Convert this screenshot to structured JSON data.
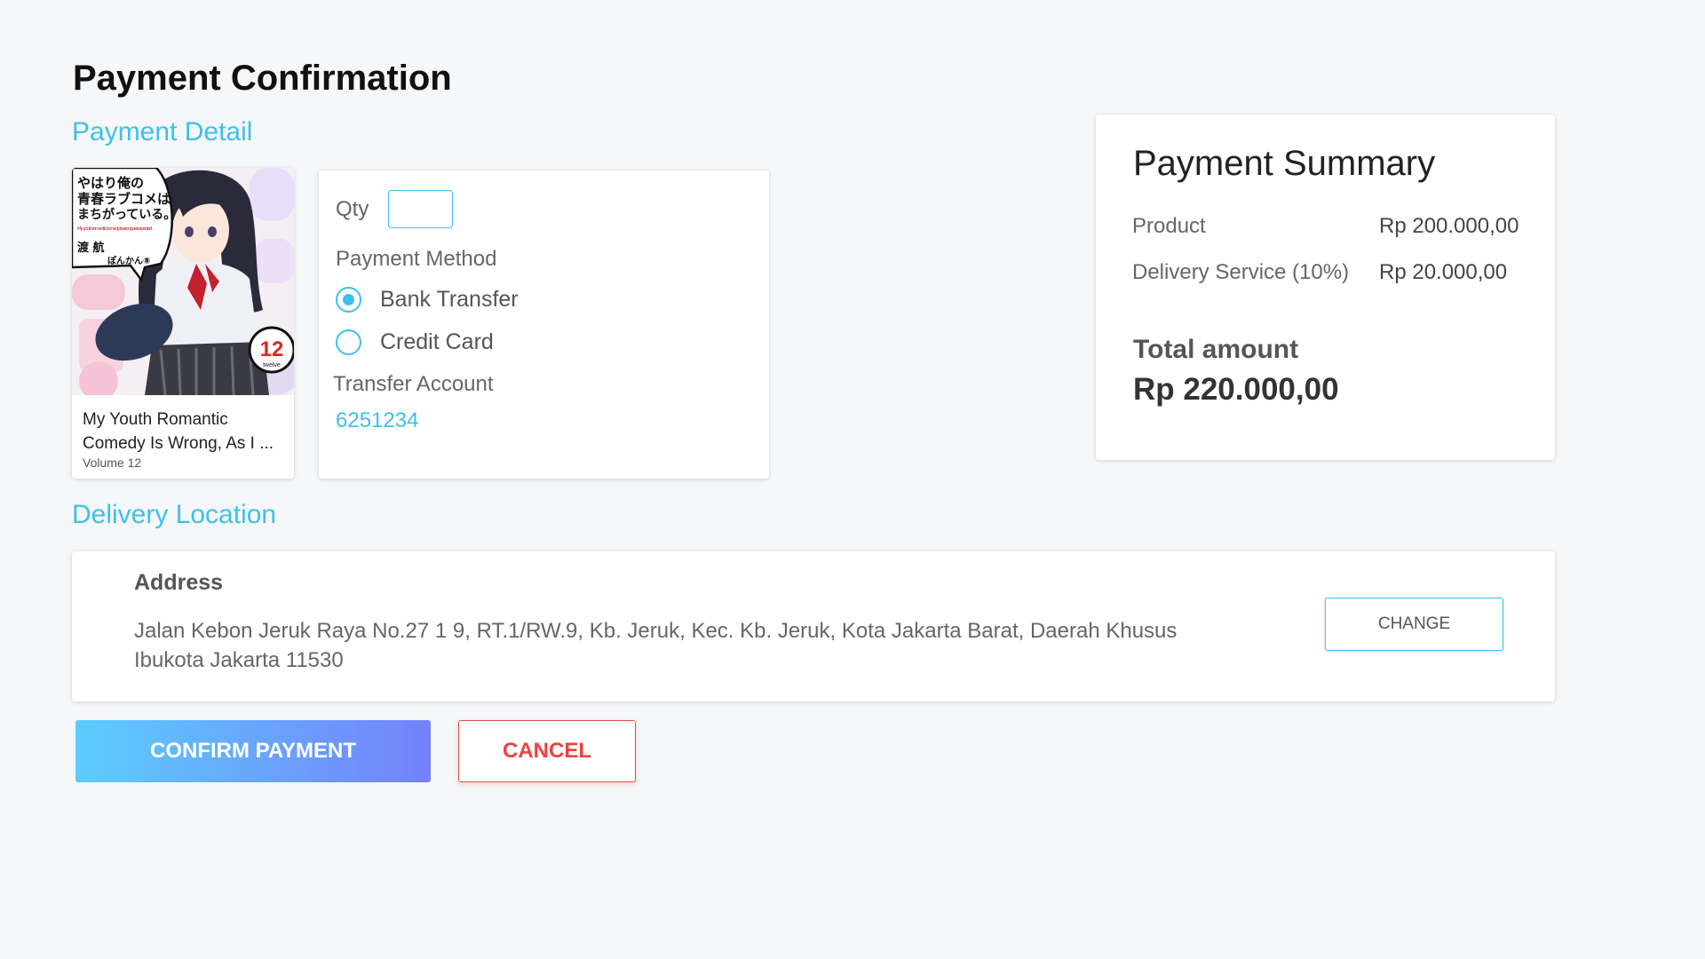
{
  "page": {
    "title": "Payment Confirmation"
  },
  "payment_detail": {
    "section_title": "Payment Detail",
    "product": {
      "name": "My Youth Romantic Comedy Is Wrong, As I ...",
      "volume": "Volume 12",
      "cover": {
        "title_jp_line1": "やはり俺の",
        "title_jp_line2": "青春ラブコメは",
        "title_jp_line3": "まちがっている。",
        "subtitle_en": "My youth romantic comedy is wrong as I expected.",
        "author": "渡 航",
        "illustrator": "ぽんかん⑧",
        "volume_number": "12",
        "volume_word": "twelve"
      }
    },
    "form": {
      "qty_label": "Qty",
      "qty_value": "",
      "payment_method_label": "Payment Method",
      "methods": [
        {
          "label": "Bank Transfer",
          "selected": true
        },
        {
          "label": "Credit Card",
          "selected": false
        }
      ],
      "transfer_account_label": "Transfer Account",
      "transfer_account_value": "6251234"
    }
  },
  "summary": {
    "title": "Payment Summary",
    "rows": [
      {
        "label": "Product",
        "value": "Rp 200.000,00"
      },
      {
        "label": "Delivery Service (10%)",
        "value": "Rp 20.000,00"
      }
    ],
    "total_label": "Total amount",
    "total_value": "Rp 220.000,00"
  },
  "delivery": {
    "section_title": "Delivery Location",
    "address_title": "Address",
    "address_text": "Jalan Kebon Jeruk Raya No.27 1 9, RT.1/RW.9, Kb. Jeruk, Kec. Kb. Jeruk, Kota Jakarta Barat, Daerah Khusus Ibukota Jakarta 11530",
    "change_label": "CHANGE"
  },
  "actions": {
    "confirm_label": "CONFIRM PAYMENT",
    "cancel_label": "CANCEL"
  },
  "colors": {
    "accent": "#3ec0ec",
    "background": "#f5f7f9",
    "confirm_gradient_start": "#5ccdfd",
    "confirm_gradient_end": "#7481fb",
    "cancel": "#ef4040"
  }
}
